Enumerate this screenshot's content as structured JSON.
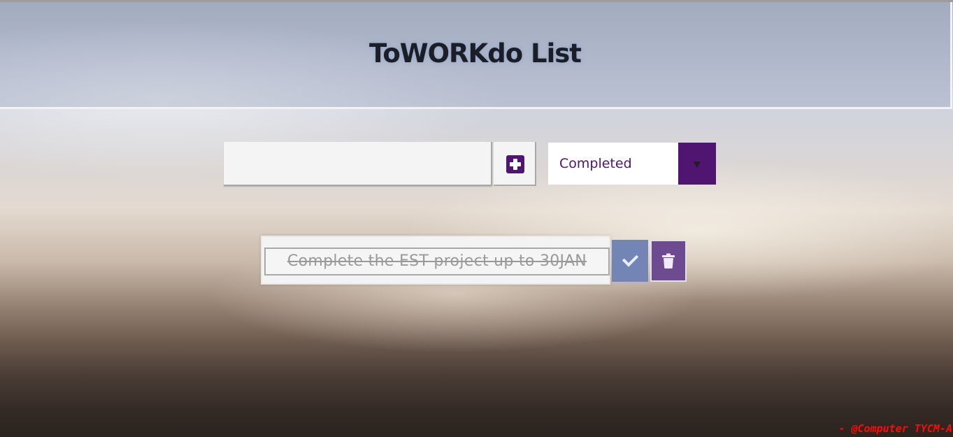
{
  "header": {
    "title": "ToWORKdo List"
  },
  "todo_form": {
    "input_value": "",
    "input_placeholder": "",
    "add_icon": "plus-square-icon",
    "filter_selected": "Completed",
    "filter_arrow_icon": "chevron-down-icon"
  },
  "todos": [
    {
      "text": "Complete the EST project up to 30JAN",
      "completed": true,
      "complete_icon": "check-icon",
      "delete_icon": "trash-icon"
    }
  ],
  "footer": {
    "credit": "- @Computer TYCM-A"
  },
  "colors": {
    "accent": "#4f1570",
    "complete_button": "#7385b4",
    "delete_button": "#6e4a91",
    "credit_text": "#ff0a0a"
  }
}
